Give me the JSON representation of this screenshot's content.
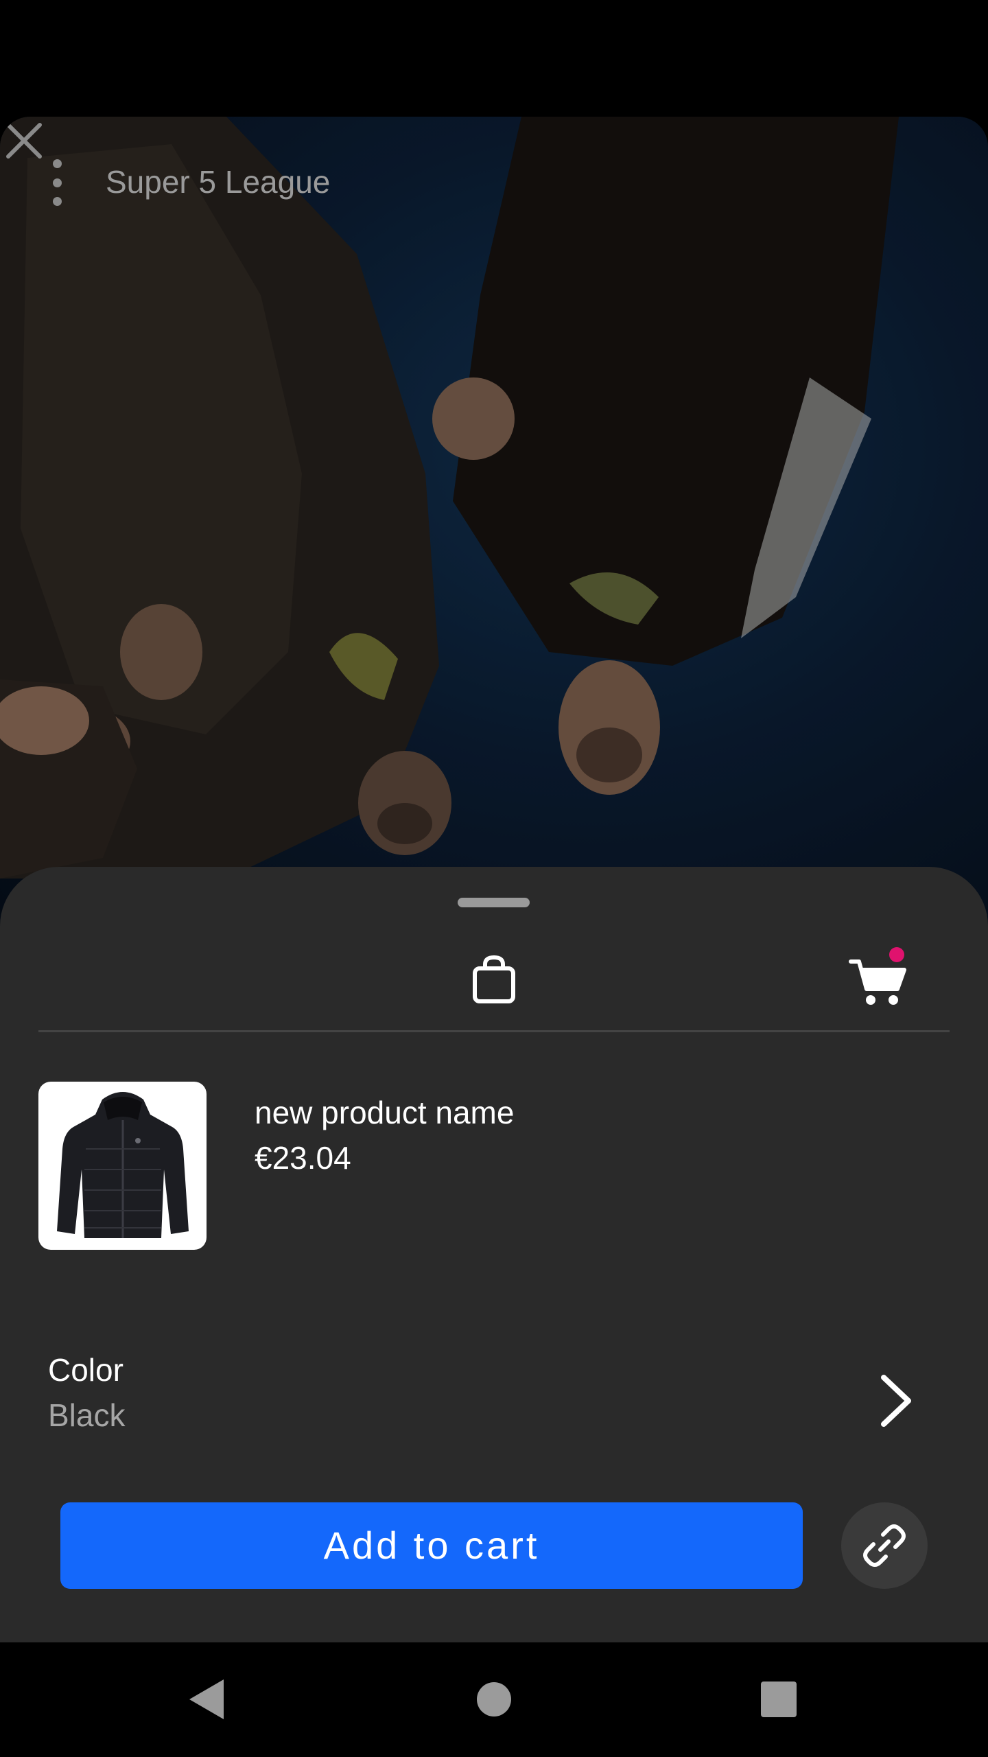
{
  "video": {
    "channel_title": "Super 5 League",
    "menu_icon": "kebab-icon",
    "close_icon": "close-icon"
  },
  "sheet": {
    "tabs": [
      {
        "icon": "shopping-bag-icon",
        "selected": true
      },
      {
        "icon": "cart-icon",
        "has_notification": true
      }
    ],
    "product": {
      "name": "new product name",
      "price": "€23.04",
      "thumbnail_icon": "jacket-icon"
    },
    "option": {
      "label": "Color",
      "value": "Black"
    },
    "primary_action": "Add to cart",
    "link_icon": "link-icon"
  },
  "navbar": {
    "items": [
      "back-icon",
      "home-icon",
      "recents-icon"
    ]
  },
  "colors": {
    "sheet_background": "#2a2a2a",
    "primary_button": "#1468fb",
    "notification_dot": "#e0126e",
    "muted_text": "#a6a6a6"
  }
}
